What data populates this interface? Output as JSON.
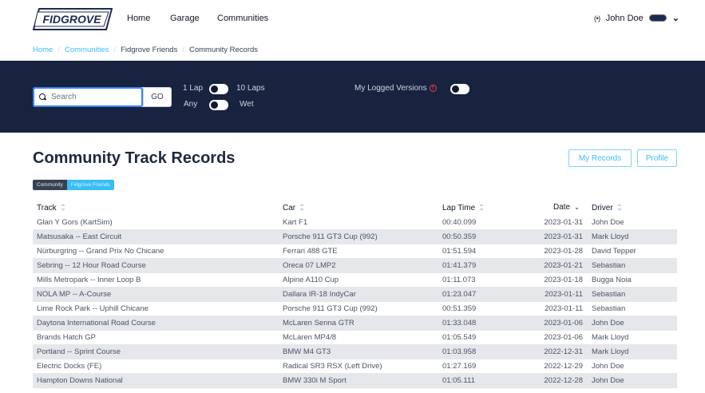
{
  "nav": {
    "logo_text": "FIDGROVE",
    "links": [
      "Home",
      "Garage",
      "Communities"
    ],
    "user_name": "John Doe"
  },
  "breadcrumb": [
    "Home",
    "Communities",
    "Fidgrove Friends",
    "Community Records"
  ],
  "filters": {
    "search_placeholder": "Search",
    "go_label": "GO",
    "lap_left": "1 Lap",
    "lap_right": "10 Laps",
    "weather_left": "Any",
    "weather_right": "Wet",
    "logged_label": "My Logged Versions"
  },
  "page": {
    "title": "Community Track Records",
    "my_records_label": "My Records",
    "profile_label": "Profile",
    "segment": [
      "Community",
      "Fidgrove Friends"
    ]
  },
  "table": {
    "headers": {
      "track": "Track",
      "car": "Car",
      "lap_time": "Lap Time",
      "date": "Date",
      "driver": "Driver"
    },
    "rows": [
      {
        "track": "Glan Y Gors (KartSim)",
        "car": "Kart F1",
        "lap_time": "00:40.099",
        "date": "2023-01-31",
        "driver": "John Doe"
      },
      {
        "track": "Matsusaka -- East Circuit",
        "car": "Porsche 911 GT3 Cup (992)",
        "lap_time": "00:50.359",
        "date": "2023-01-31",
        "driver": "Mark Lloyd"
      },
      {
        "track": "Nürburgring -- Grand Prix No Chicane",
        "car": "Ferrari 488 GTE",
        "lap_time": "01:51.594",
        "date": "2023-01-28",
        "driver": "David Tepper"
      },
      {
        "track": "Sebring -- 12 Hour Road Course",
        "car": "Oreca 07 LMP2",
        "lap_time": "01:41.379",
        "date": "2023-01-21",
        "driver": "Sebastian"
      },
      {
        "track": "Mills Metropark -- Inner Loop B",
        "car": "Alpine A110 Cup",
        "lap_time": "01:11.073",
        "date": "2023-01-18",
        "driver": "Bugga Noia"
      },
      {
        "track": "NOLA MP -- A-Course",
        "car": "Dallara IR-18 IndyCar",
        "lap_time": "01:23.047",
        "date": "2023-01-11",
        "driver": "Sebastian"
      },
      {
        "track": "Lime Rock Park -- Uphill Chicane",
        "car": "Porsche 911 GT3 Cup (992)",
        "lap_time": "00:51.359",
        "date": "2023-01-11",
        "driver": "Sebastian"
      },
      {
        "track": "Daytona International Road Course",
        "car": "McLaren Senna GTR",
        "lap_time": "01:33.048",
        "date": "2023-01-06",
        "driver": "John Doe"
      },
      {
        "track": "Brands Hatch GP",
        "car": "McLaren MP4/8",
        "lap_time": "01:05.549",
        "date": "2023-01-06",
        "driver": "Mark Lloyd"
      },
      {
        "track": "Portland -- Sprint Course",
        "car": "BMW M4 GT3",
        "lap_time": "01:03.958",
        "date": "2022-12-31",
        "driver": "Mark Lloyd"
      },
      {
        "track": "Electric Docks (FE)",
        "car": "Radical SR3 RSX (Left Drive)",
        "lap_time": "01:27.169",
        "date": "2022-12-29",
        "driver": "John Doe"
      },
      {
        "track": "Hampton Downs National",
        "car": "BMW 330i M Sport",
        "lap_time": "01:05.111",
        "date": "2022-12-28",
        "driver": "John Doe"
      }
    ]
  },
  "colors": {
    "band": "#17233f",
    "accent": "#38bdf8",
    "row_alt": "#e5e7eb"
  }
}
